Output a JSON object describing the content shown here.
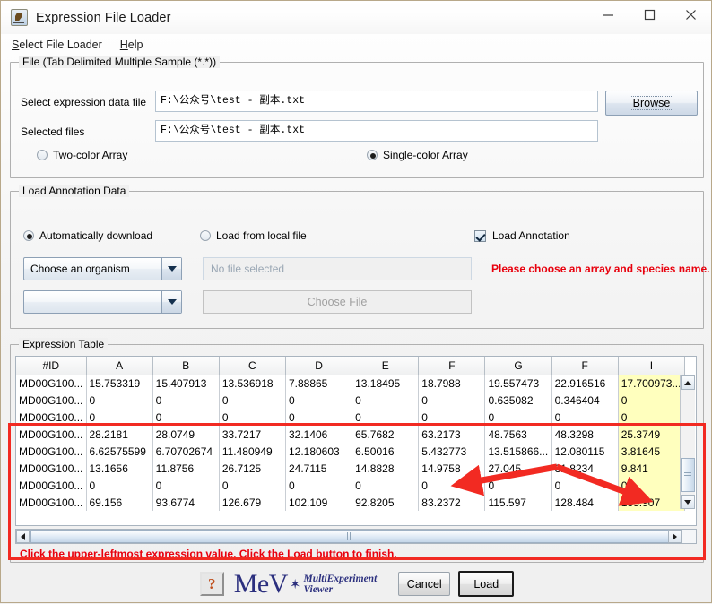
{
  "window": {
    "title": "Expression File Loader",
    "icon": "java-coffee-icon",
    "controls": {
      "minimize": "–",
      "maximize": "□",
      "close": "✕"
    }
  },
  "menubar": {
    "items": [
      {
        "label": "Select File Loader",
        "mnemonic": "S"
      },
      {
        "label": "Help",
        "mnemonic": "H"
      }
    ]
  },
  "file_group": {
    "legend": "File    (Tab Delimited Multiple Sample (*.*))",
    "select_label": "Select expression data file",
    "select_value": "F:\\公众号\\test - 副本.txt",
    "selected_label": "Selected files",
    "selected_value": "F:\\公众号\\test - 副本.txt",
    "browse_label": "Browse",
    "two_color_label": "Two-color Array",
    "two_color_selected": false,
    "single_color_label": "Single-color Array",
    "single_color_selected": true
  },
  "annotation_group": {
    "legend": "Load Annotation Data",
    "auto_download_label": "Automatically download",
    "auto_download_selected": true,
    "local_file_label": "Load from local file",
    "local_file_selected": false,
    "load_annotation_label": "Load Annotation",
    "load_annotation_checked": true,
    "organism_combo_value": "Choose an organism",
    "array_combo_value": "",
    "no_file_placeholder": "No file selected",
    "choose_file_label": "Choose File",
    "warning": "Please choose an array and species name."
  },
  "table_group": {
    "legend": "Expression Table",
    "columns": [
      "#ID",
      "A",
      "B",
      "C",
      "D",
      "E",
      "F",
      "G",
      "F",
      "I"
    ],
    "highlighted_column_index": 9,
    "rows": [
      [
        "MD00G100...",
        "15.753319",
        "15.407913",
        "13.536918",
        "7.88865",
        "13.18495",
        "18.7988",
        "19.557473",
        "22.916516",
        "17.700973..."
      ],
      [
        "MD00G100...",
        "0",
        "0",
        "0",
        "0",
        "0",
        "0",
        "0.635082",
        "0.346404",
        "0"
      ],
      [
        "MD00G100...",
        "0",
        "0",
        "0",
        "0",
        "0",
        "0",
        "0",
        "0",
        "0"
      ],
      [
        "MD00G100...",
        "28.2181",
        "28.0749",
        "33.7217",
        "32.1406",
        "65.7682",
        "63.2173",
        "48.7563",
        "48.3298",
        "25.3749"
      ],
      [
        "MD00G100...",
        "6.62575599",
        "6.70702674",
        "11.480949",
        "12.180603",
        "6.50016",
        "5.432773",
        "13.515866...",
        "12.080115",
        "3.81645"
      ],
      [
        "MD00G100...",
        "13.1656",
        "11.8756",
        "26.7125",
        "24.7115",
        "14.8828",
        "14.9758",
        "27.045",
        "31.8234",
        "9.841"
      ],
      [
        "MD00G100...",
        "0",
        "0",
        "0",
        "0",
        "0",
        "0",
        "0",
        "0",
        "0"
      ],
      [
        "MD00G100...",
        "69.156",
        "93.6774",
        "126.679",
        "102.109",
        "92.8205",
        "83.2372",
        "115.597",
        "128.484",
        "135.907"
      ]
    ],
    "hint": "Click the upper-leftmost expression value. Click the Load button to finish."
  },
  "footer": {
    "help_glyph": "?",
    "logo_word": "MeV",
    "logo_star": "✶",
    "logo_sub_line1": "MultiExperiment",
    "logo_sub_line2": "Viewer",
    "cancel_label": "Cancel",
    "load_label": "Load"
  },
  "colors": {
    "warning_red": "#e8000d",
    "annotation_red": "#f22a22",
    "selection_yellow": "#ffffbe",
    "logo_blue": "#2b2f7e"
  }
}
